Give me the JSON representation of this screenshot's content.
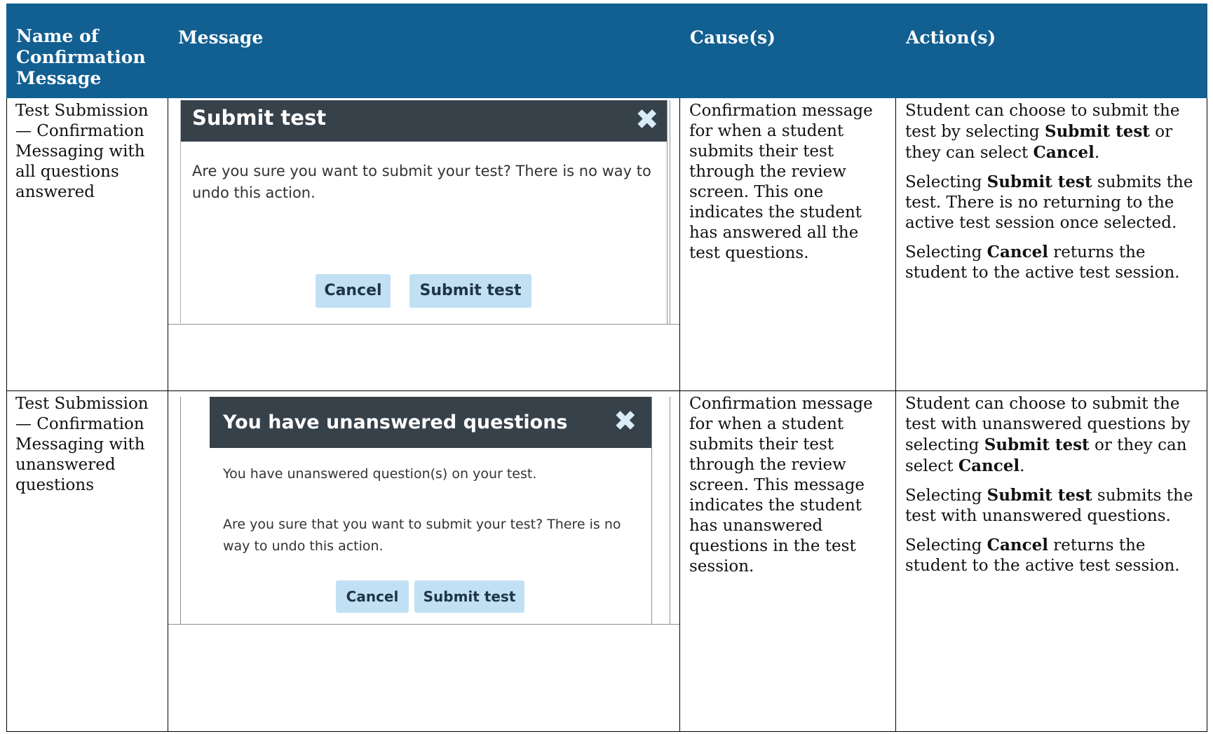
{
  "headers": {
    "name": "Name of Confirmation Message",
    "message": "Message",
    "causes": "Cause(s)",
    "actions": "Action(s)"
  },
  "rows": [
    {
      "name": "Test Submission — Confirmation Messaging with all questions answered",
      "dialog": {
        "title": "Submit test",
        "close_icon": "close-x-icon",
        "body": [
          "Are you sure you want to submit your test? There is no way to undo this action."
        ],
        "cancel_label": "Cancel",
        "submit_label": "Submit test"
      },
      "cause": "Confirmation message for when a student submits their test through the review screen. This one indicates the student has answered all the test questions.",
      "actions": [
        {
          "pre": "Student can choose to submit the test by selecting ",
          "b1": "Submit test",
          "mid": " or they can select ",
          "b2": "Cancel",
          "post": "."
        },
        {
          "pre": "Selecting ",
          "b1": "Submit test",
          "post": " submits the test. There is no returning to the active test session once selected."
        },
        {
          "pre": "Selecting ",
          "b1": "Cancel",
          "post": " returns the student to the active test session."
        }
      ]
    },
    {
      "name": "Test Submission — Confirmation Messaging with unanswered questions",
      "dialog": {
        "title": "You have unanswered questions",
        "close_icon": "close-x-icon",
        "body": [
          "You have unanswered question(s) on your test.",
          "Are you sure that you want to submit your test? There is no way to undo this action."
        ],
        "cancel_label": "Cancel",
        "submit_label": "Submit test"
      },
      "cause": "Confirmation message for when a student submits their test through the review screen. This message indicates the student has unanswered questions in the test session.",
      "actions": [
        {
          "pre": "Student can choose to submit the test with unanswered questions by selecting ",
          "b1": "Submit test",
          "mid": " or they can select ",
          "b2": "Cancel",
          "post": "."
        },
        {
          "pre": "Selecting ",
          "b1": "Submit test",
          "post": " submits the test with unanswered questions."
        },
        {
          "pre": "Selecting ",
          "b1": "Cancel",
          "post": " returns the student to the active test session."
        }
      ]
    }
  ],
  "colors": {
    "header_bg": "#125F91",
    "dialog_title_bg": "#37414a",
    "button_bg": "#c2e0f4"
  }
}
